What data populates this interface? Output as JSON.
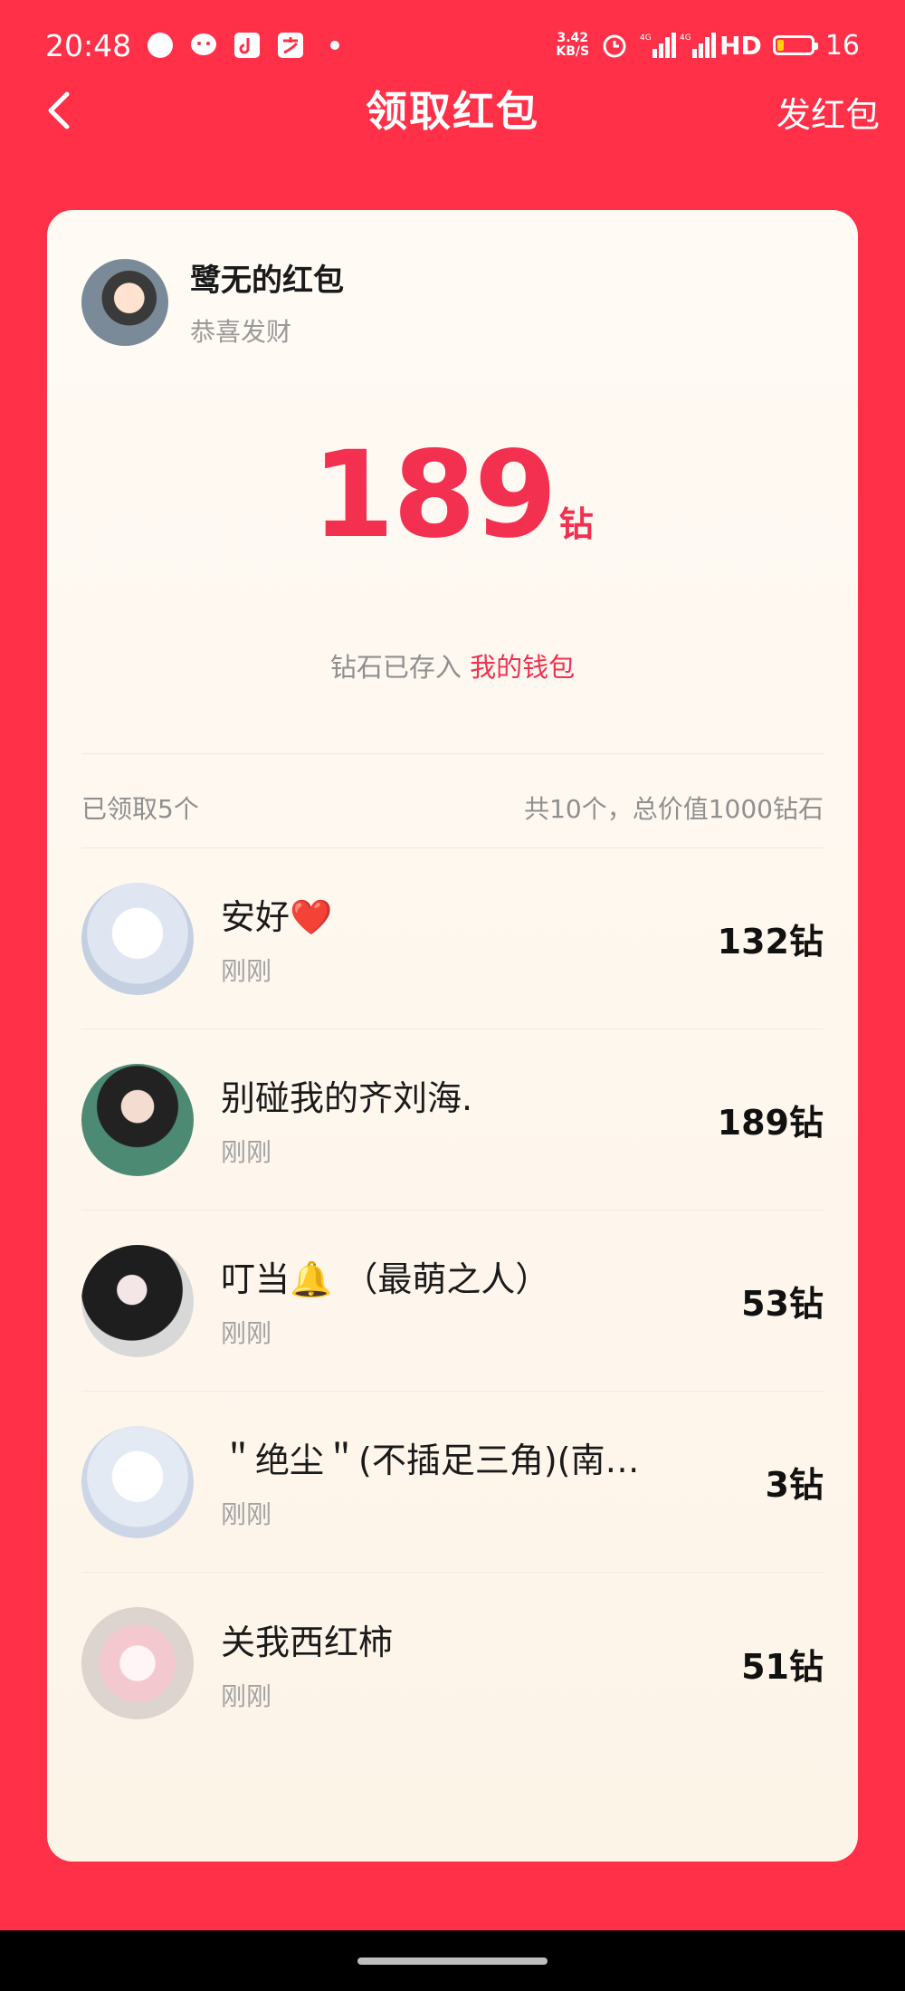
{
  "status_bar": {
    "time": "20:48",
    "net_speed_value": "3.42",
    "net_speed_unit": "KB/S",
    "signal_1": "4G",
    "signal_2": "4G",
    "hd": "HD",
    "battery": "16"
  },
  "nav": {
    "title": "领取红包",
    "send_label": "发红包"
  },
  "sender": {
    "name": "鹭无的红包",
    "message": "恭喜发财"
  },
  "received": {
    "amount": "189",
    "unit": "钻",
    "stored_text": "钻石已存入",
    "wallet_link": "我的钱包"
  },
  "summary": {
    "claimed": "已领取5个",
    "total": "共10个，总价值1000钻石"
  },
  "claims": [
    {
      "name": "安好❤️",
      "time": "刚刚",
      "amount": "132钻"
    },
    {
      "name": "别碰我的齐刘海.",
      "time": "刚刚",
      "amount": "189钻"
    },
    {
      "name": "叮当🔔 （最萌之人）",
      "time": "刚刚",
      "amount": "53钻"
    },
    {
      "name": "＂绝尘＂(不插足三角)(南…",
      "time": "刚刚",
      "amount": "3钻"
    },
    {
      "name": "关我西红柿",
      "time": "刚刚",
      "amount": "51钻"
    }
  ],
  "colors": {
    "background": "#ff3047",
    "accent": "#f33050"
  }
}
